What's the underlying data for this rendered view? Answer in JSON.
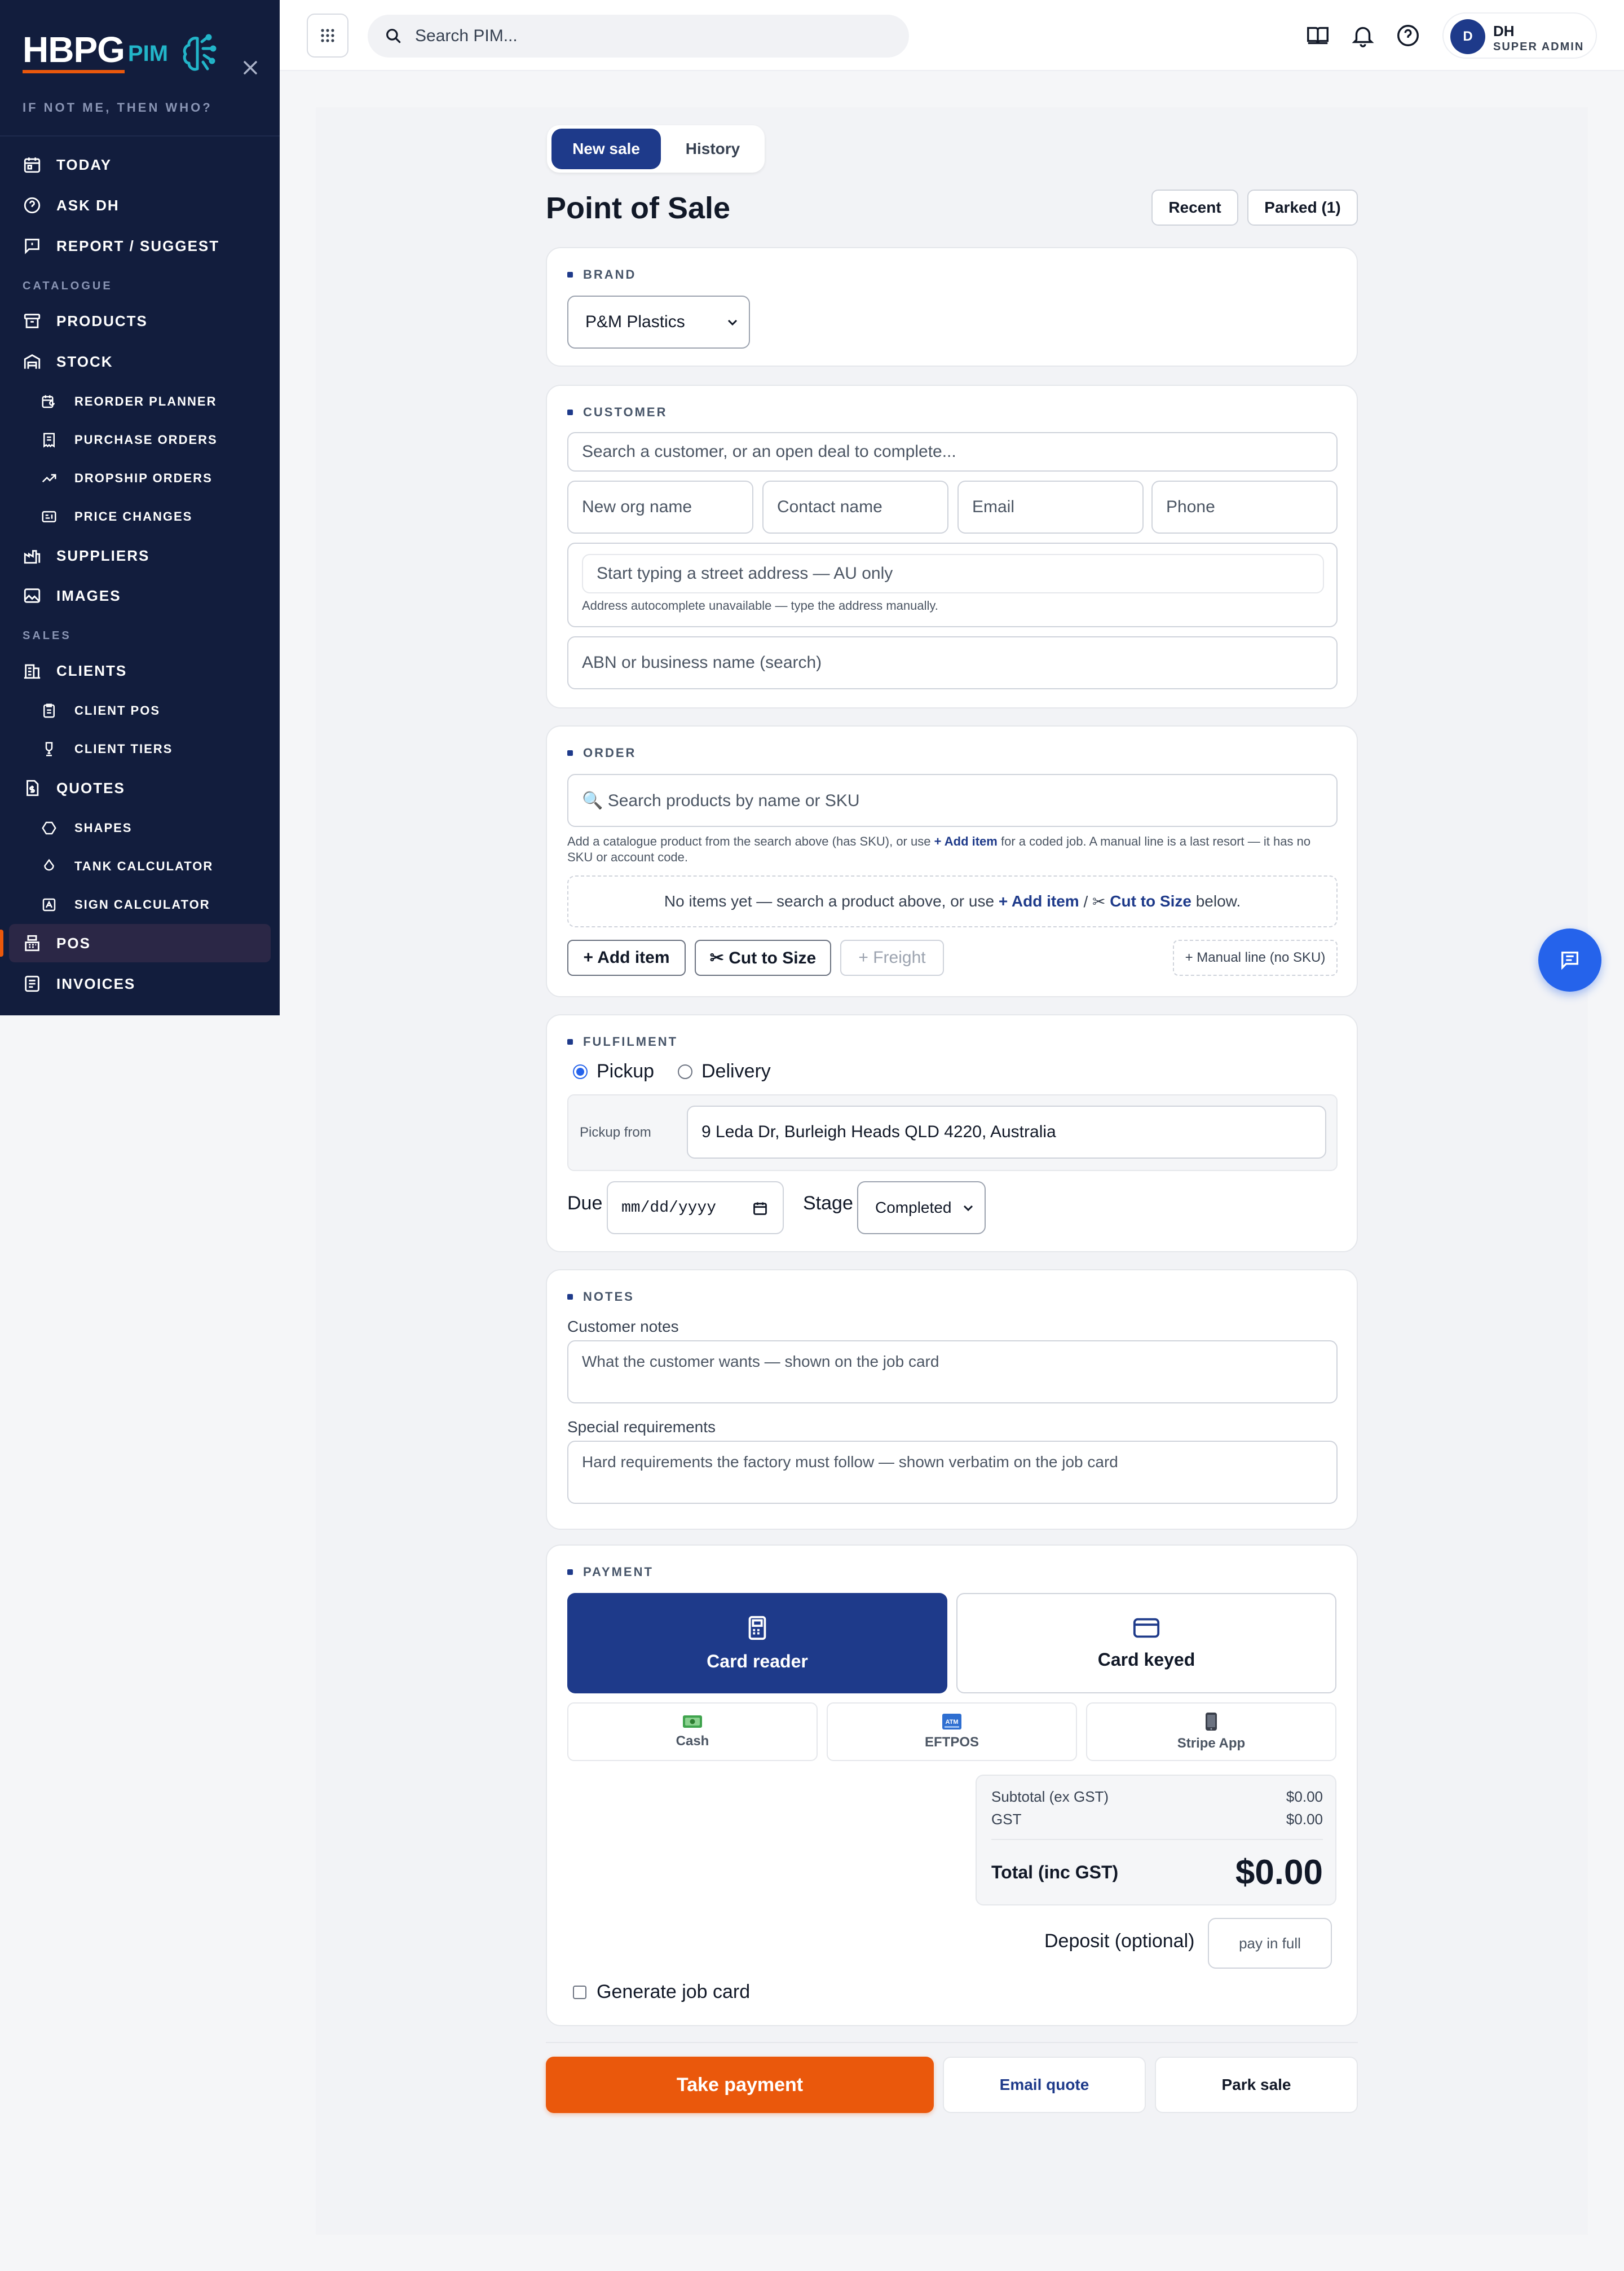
{
  "sidebar": {
    "logo": {
      "main": "HBPG",
      "sub": "PIM"
    },
    "tagline": "IF NOT ME, THEN WHO?",
    "sections": {
      "catalogue": "CATALOGUE",
      "sales": "SALES"
    },
    "items": [
      {
        "label": "TODAY",
        "icon": "calendar-icon"
      },
      {
        "label": "ASK DH",
        "icon": "help-circle-icon"
      },
      {
        "label": "REPORT / SUGGEST",
        "icon": "message-square-icon"
      },
      {
        "label": "PRODUCTS",
        "icon": "archive-box-icon"
      },
      {
        "label": "STOCK",
        "icon": "warehouse-icon"
      },
      {
        "label": "REORDER PLANNER",
        "icon": "calendar-refresh-icon"
      },
      {
        "label": "PURCHASE ORDERS",
        "icon": "receipt-icon"
      },
      {
        "label": "DROPSHIP ORDERS",
        "icon": "trending-up-icon"
      },
      {
        "label": "PRICE CHANGES",
        "icon": "price-tag-icon"
      },
      {
        "label": "SUPPLIERS",
        "icon": "factory-icon"
      },
      {
        "label": "IMAGES",
        "icon": "image-icon"
      },
      {
        "label": "CLIENTS",
        "icon": "building-icon"
      },
      {
        "label": "CLIENT POS",
        "icon": "clipboard-icon"
      },
      {
        "label": "CLIENT TIERS",
        "icon": "trophy-icon"
      },
      {
        "label": "QUOTES",
        "icon": "document-dollar-icon"
      },
      {
        "label": "SHAPES",
        "icon": "hexagon-icon"
      },
      {
        "label": "TANK CALCULATOR",
        "icon": "droplet-icon"
      },
      {
        "label": "SIGN CALCULATOR",
        "icon": "sign-icon"
      },
      {
        "label": "POS",
        "icon": "register-icon"
      },
      {
        "label": "INVOICES",
        "icon": "invoice-icon"
      }
    ]
  },
  "topbar": {
    "search_placeholder": "Search PIM...",
    "user": {
      "initial": "D",
      "name": "DH",
      "role": "SUPER ADMIN"
    }
  },
  "pos": {
    "tabs": {
      "new_sale": "New sale",
      "history": "History"
    },
    "title": "Point of Sale",
    "recent": "Recent",
    "parked": "Parked (1)",
    "brand": {
      "title": "BRAND",
      "selected": "P&M Plastics"
    },
    "customer": {
      "title": "CUSTOMER",
      "search_placeholder": "Search a customer, or an open deal to complete...",
      "org_placeholder": "New org name",
      "contact_placeholder": "Contact name",
      "email_placeholder": "Email",
      "phone_placeholder": "Phone",
      "address_placeholder": "Start typing a street address — AU only",
      "address_note": "Address autocomplete unavailable — type the address manually.",
      "abn_placeholder": "ABN or business name (search)"
    },
    "order": {
      "title": "ORDER",
      "search_placeholder": "🔍 Search products by name or SKU",
      "hint_1": "Add a catalogue product from the search above (has SKU), or use ",
      "hint_add": "+ Add item",
      "hint_2": " for a coded job. A manual line is a last resort — it has no SKU or account code.",
      "empty_1": "No items yet — search a product above, or use ",
      "empty_add": "+ Add item",
      "empty_sep": " / ✂ ",
      "empty_cut": "Cut to Size",
      "empty_2": " below.",
      "add_item": "+ Add item",
      "cut_to_size": "✂ Cut to Size",
      "freight": "+ Freight",
      "manual_line": "+ Manual line (no SKU)"
    },
    "fulfilment": {
      "title": "FULFILMENT",
      "pickup": "Pickup",
      "delivery": "Delivery",
      "pickup_from_label": "Pickup from",
      "pickup_from_value": "9 Leda Dr, Burleigh Heads QLD 4220, Australia",
      "due_label": "Due",
      "due_placeholder": "mm/dd/yyyy",
      "stage_label": "Stage",
      "stage_value": "Completed"
    },
    "notes": {
      "title": "NOTES",
      "customer_label": "Customer notes",
      "customer_placeholder": "What the customer wants — shown on the job card",
      "special_label": "Special requirements",
      "special_placeholder": "Hard requirements the factory must follow — shown verbatim on the job card"
    },
    "payment": {
      "title": "PAYMENT",
      "card_reader": "Card reader",
      "card_keyed": "Card keyed",
      "cash": "Cash",
      "eftpos": "EFTPOS",
      "stripe": "Stripe App",
      "subtotal_label": "Subtotal (ex GST)",
      "subtotal_value": "$0.00",
      "gst_label": "GST",
      "gst_value": "$0.00",
      "total_label": "Total (inc GST)",
      "total_value": "$0.00",
      "deposit_label": "Deposit (optional)",
      "deposit_placeholder": "pay in full",
      "job_card_label": "Generate job card"
    },
    "actions": {
      "take_payment": "Take payment",
      "email_quote": "Email quote",
      "park_sale": "Park sale"
    }
  },
  "colors": {
    "navy": "#1e3a8a",
    "orange": "#ea580c",
    "sidebar": "#121d3d",
    "fab": "#2563eb"
  }
}
